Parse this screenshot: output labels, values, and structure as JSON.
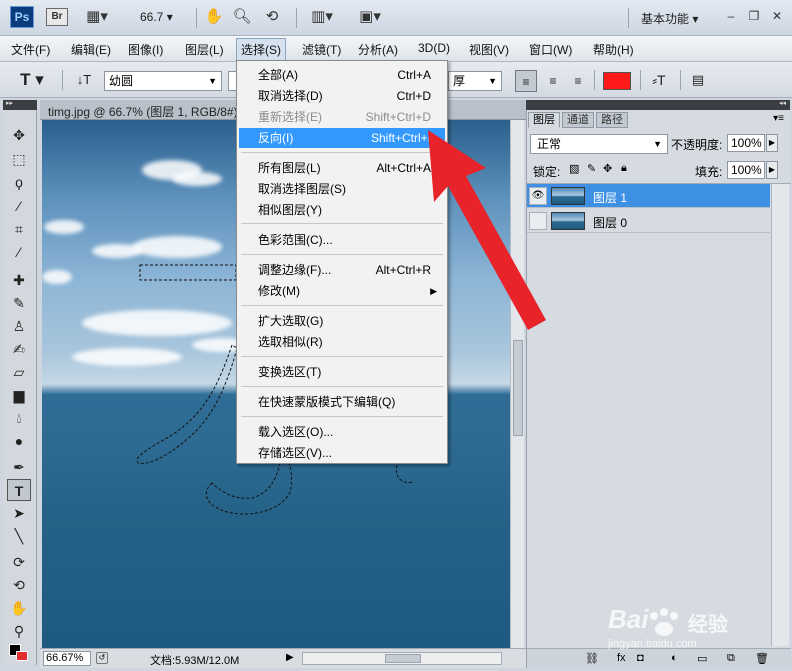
{
  "titlebar": {
    "ps_logo": "Ps",
    "br_logo": "Br",
    "zoom": "66.7",
    "workspace": "基本功能",
    "icons": [
      "film-strip-icon",
      "hand-icon",
      "zoom-icon",
      "rotate-view-icon",
      "arrange-icon",
      "screen-mode-icon"
    ]
  },
  "menubar": {
    "items": [
      "文件(F)",
      "编辑(E)",
      "图像(I)",
      "图层(L)",
      "选择(S)",
      "滤镜(T)",
      "分析(A)",
      "3D(D)",
      "视图(V)",
      "窗口(W)",
      "帮助(H)"
    ]
  },
  "options": {
    "font_family": "幼圆",
    "aa": "厚",
    "color": "#ff1a1a"
  },
  "document": {
    "tab_title": "timg.jpg @ 66.7% (图层 1, RGB/8#)",
    "zoom_field": "66.67%",
    "doc_info": "文档:5.93M/12.0M"
  },
  "layers_panel": {
    "tabs": [
      "图层",
      "通道",
      "路径"
    ],
    "blend_mode": "正常",
    "opacity_label": "不透明度:",
    "opacity_value": "100%",
    "lock_label": "锁定:",
    "fill_label": "填充:",
    "fill_value": "100%",
    "layers": [
      {
        "name": "图层 1",
        "selected": true,
        "visible": true
      },
      {
        "name": "图层 0",
        "selected": false,
        "visible": false
      }
    ]
  },
  "select_menu": {
    "items": [
      {
        "label": "全部(A)",
        "shortcut": "Ctrl+A"
      },
      {
        "label": "取消选择(D)",
        "shortcut": "Ctrl+D"
      },
      {
        "label": "重新选择(E)",
        "shortcut": "Shift+Ctrl+D",
        "disabled": true
      },
      {
        "label": "反向(I)",
        "shortcut": "Shift+Ctrl+I",
        "highlighted": true
      },
      {
        "label": "所有图层(L)",
        "shortcut": "Alt+Ctrl+A"
      },
      {
        "label": "取消选择图层(S)",
        "shortcut": ""
      },
      {
        "label": "相似图层(Y)",
        "shortcut": ""
      },
      {
        "label": "色彩范围(C)...",
        "shortcut": ""
      },
      {
        "label": "调整边缘(F)...",
        "shortcut": "Alt+Ctrl+R"
      },
      {
        "label": "修改(M)",
        "shortcut": "",
        "submenu": true
      },
      {
        "label": "扩大选取(G)",
        "shortcut": ""
      },
      {
        "label": "选取相似(R)",
        "shortcut": ""
      },
      {
        "label": "变换选区(T)",
        "shortcut": ""
      },
      {
        "label": "在快速蒙版模式下编辑(Q)",
        "shortcut": ""
      },
      {
        "label": "载入选区(O)...",
        "shortcut": ""
      },
      {
        "label": "存储选区(V)...",
        "shortcut": ""
      }
    ]
  },
  "watermark": {
    "brand": "Bai",
    "brand2": "经验",
    "url": "jingyan.baidu.com"
  },
  "colors": {
    "accent": "#3399ff",
    "arrow": "#e8232a"
  }
}
